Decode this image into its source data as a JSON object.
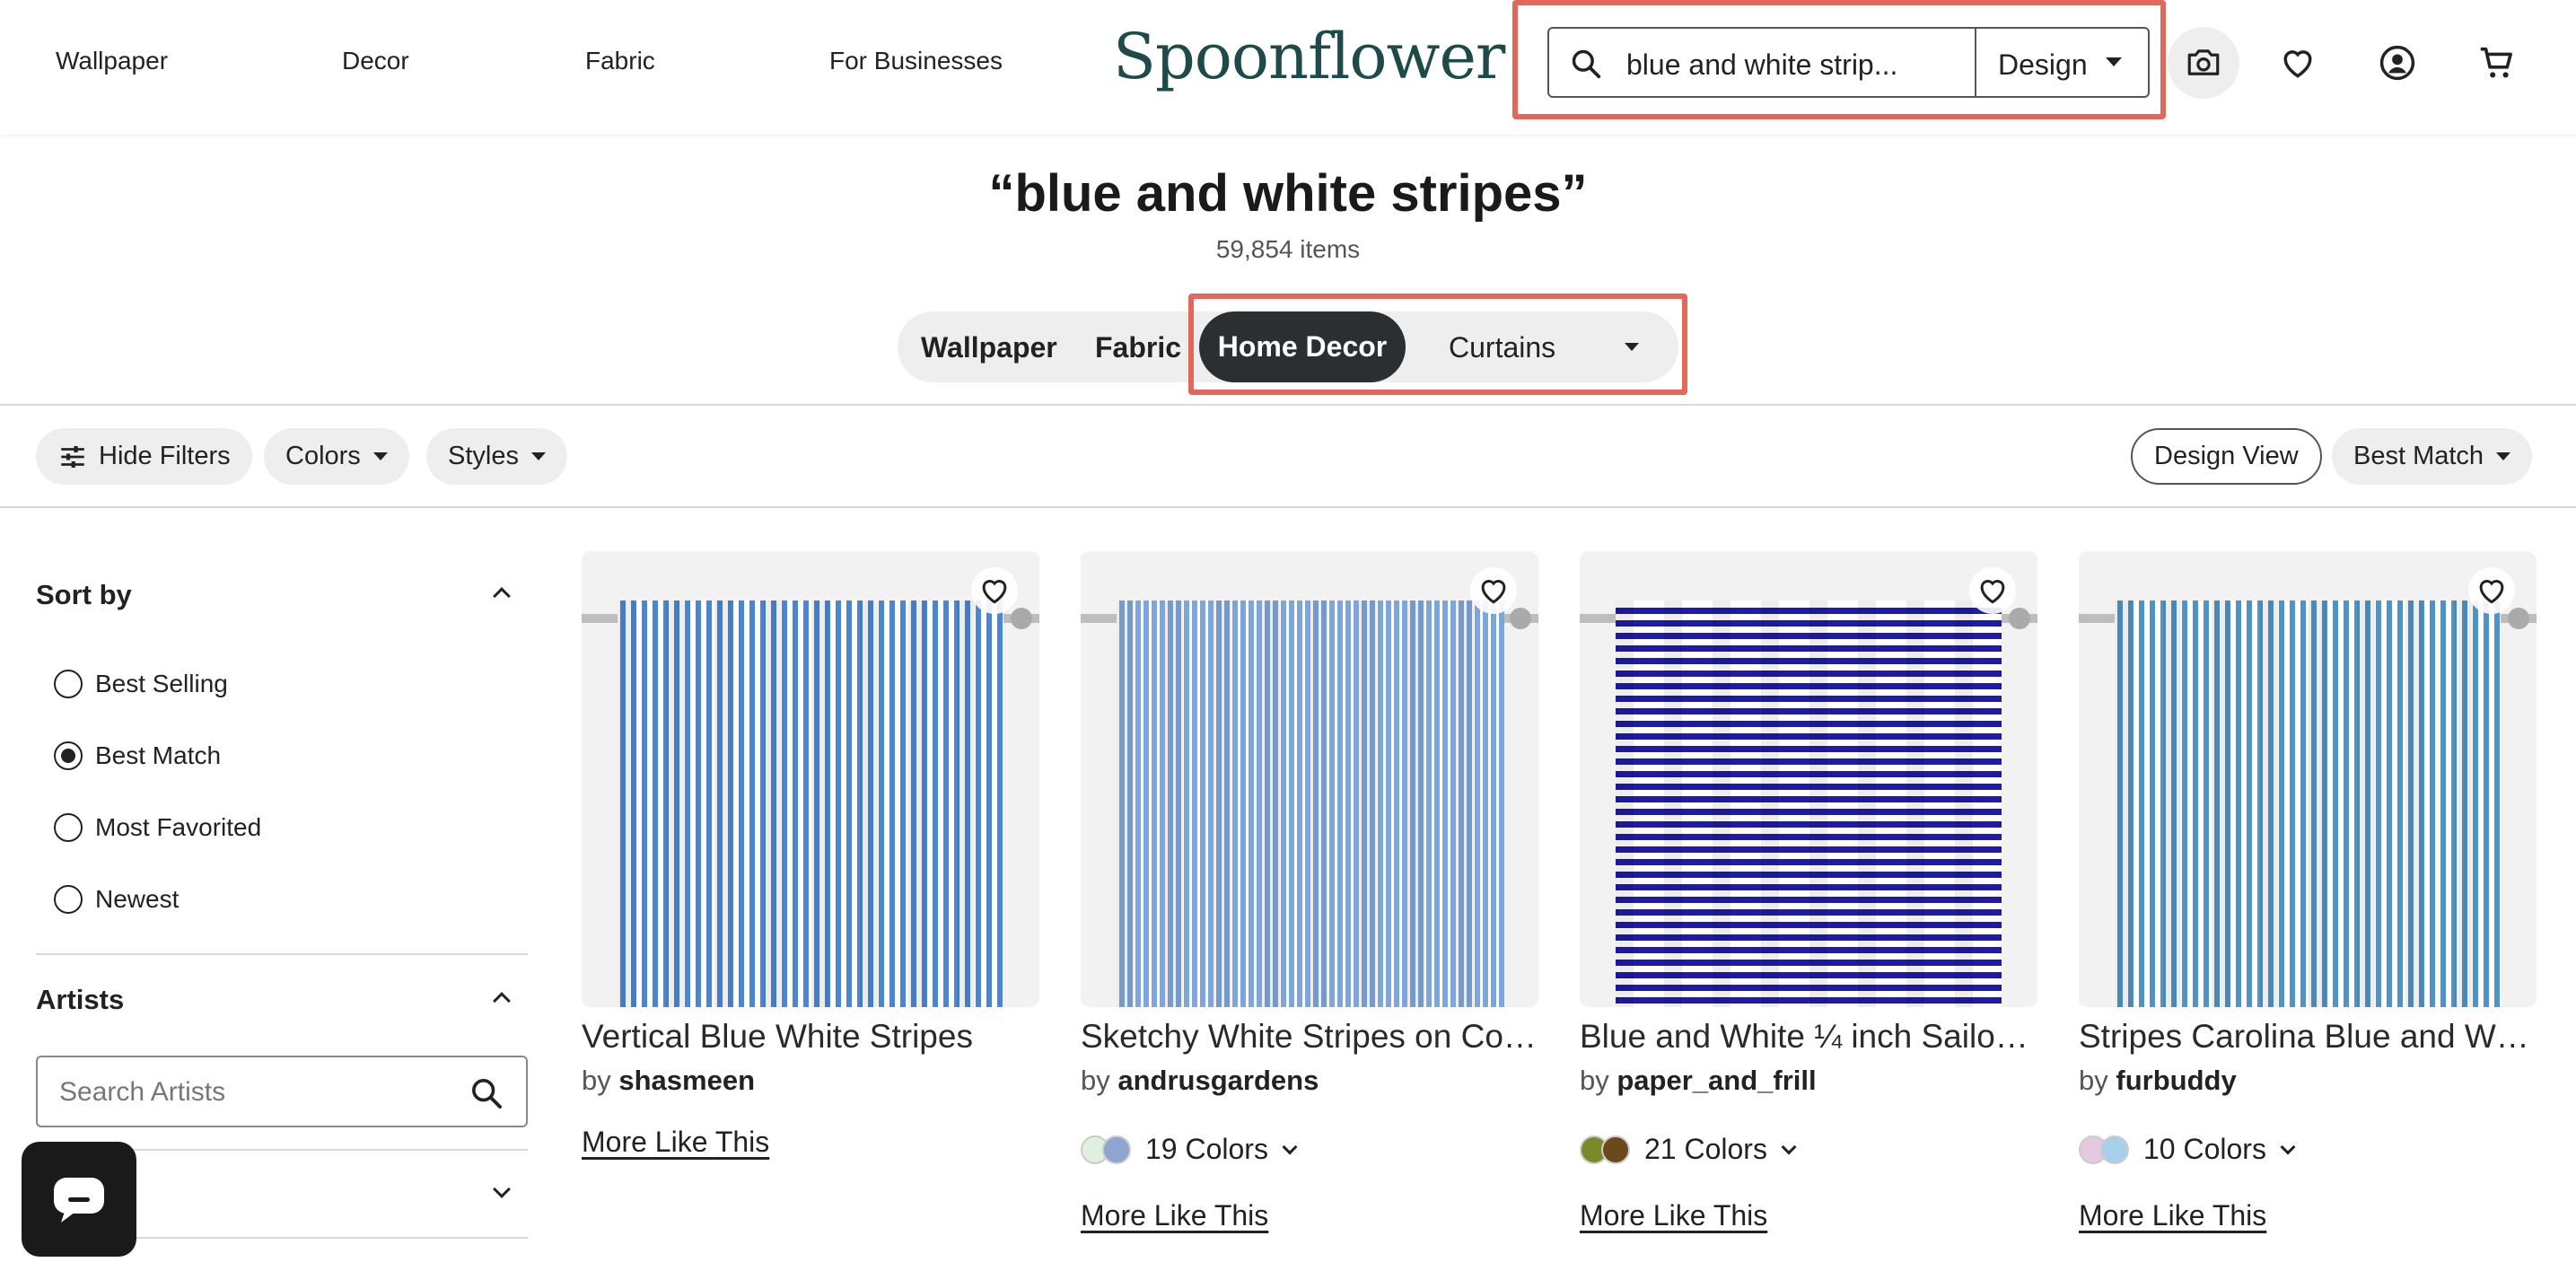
{
  "header": {
    "nav": [
      "Wallpaper",
      "Decor",
      "Fabric",
      "For Businesses"
    ],
    "logo": "Spoonflower",
    "search_value": "blue and white strip...",
    "search_type": "Design"
  },
  "results": {
    "query_title": "“blue and white stripes”",
    "count": "59,854 items"
  },
  "categories": {
    "items": [
      "Wallpaper",
      "Fabric"
    ],
    "active": "Home Decor",
    "subcategory": "Curtains"
  },
  "filters": {
    "hide_filters": "Hide Filters",
    "colors": "Colors",
    "styles": "Styles",
    "design_view": "Design View",
    "sort": "Best Match"
  },
  "sidebar": {
    "sort_heading": "Sort by",
    "sort_options": [
      "Best Selling",
      "Best Match",
      "Most Favorited",
      "Newest"
    ],
    "selected_sort": "Best Match",
    "artists_heading": "Artists",
    "artists_placeholder": "Search Artists"
  },
  "products": [
    {
      "title": "Vertical Blue White Stripes",
      "by": "by",
      "artist": "shasmeen",
      "more": "More Like This",
      "stripe_color": "#4a86d4"
    },
    {
      "title": "Sketchy White Stripes on Cornflower Blue",
      "by": "by",
      "artist": "andrusgardens",
      "colors": "19 Colors",
      "swatches": [
        "#dff0dc",
        "#8ca6d0"
      ],
      "more": "More Like This",
      "stripe_color": "#7fa6dc"
    },
    {
      "title": "Blue and White ¼ inch Sailor Stripes",
      "by": "by",
      "artist": "paper_and_frill",
      "colors": "21 Colors",
      "swatches": [
        "#7a8a2a",
        "#6a4a1a"
      ],
      "more": "More Like This",
      "stripe_color": "#1f1aa8"
    },
    {
      "title": "Stripes Carolina Blue and White",
      "by": "by",
      "artist": "furbuddy",
      "colors": "10 Colors",
      "swatches": [
        "#e7c8e3",
        "#a9d0ea"
      ],
      "more": "More Like This",
      "stripe_color": "#4f93c8"
    }
  ]
}
